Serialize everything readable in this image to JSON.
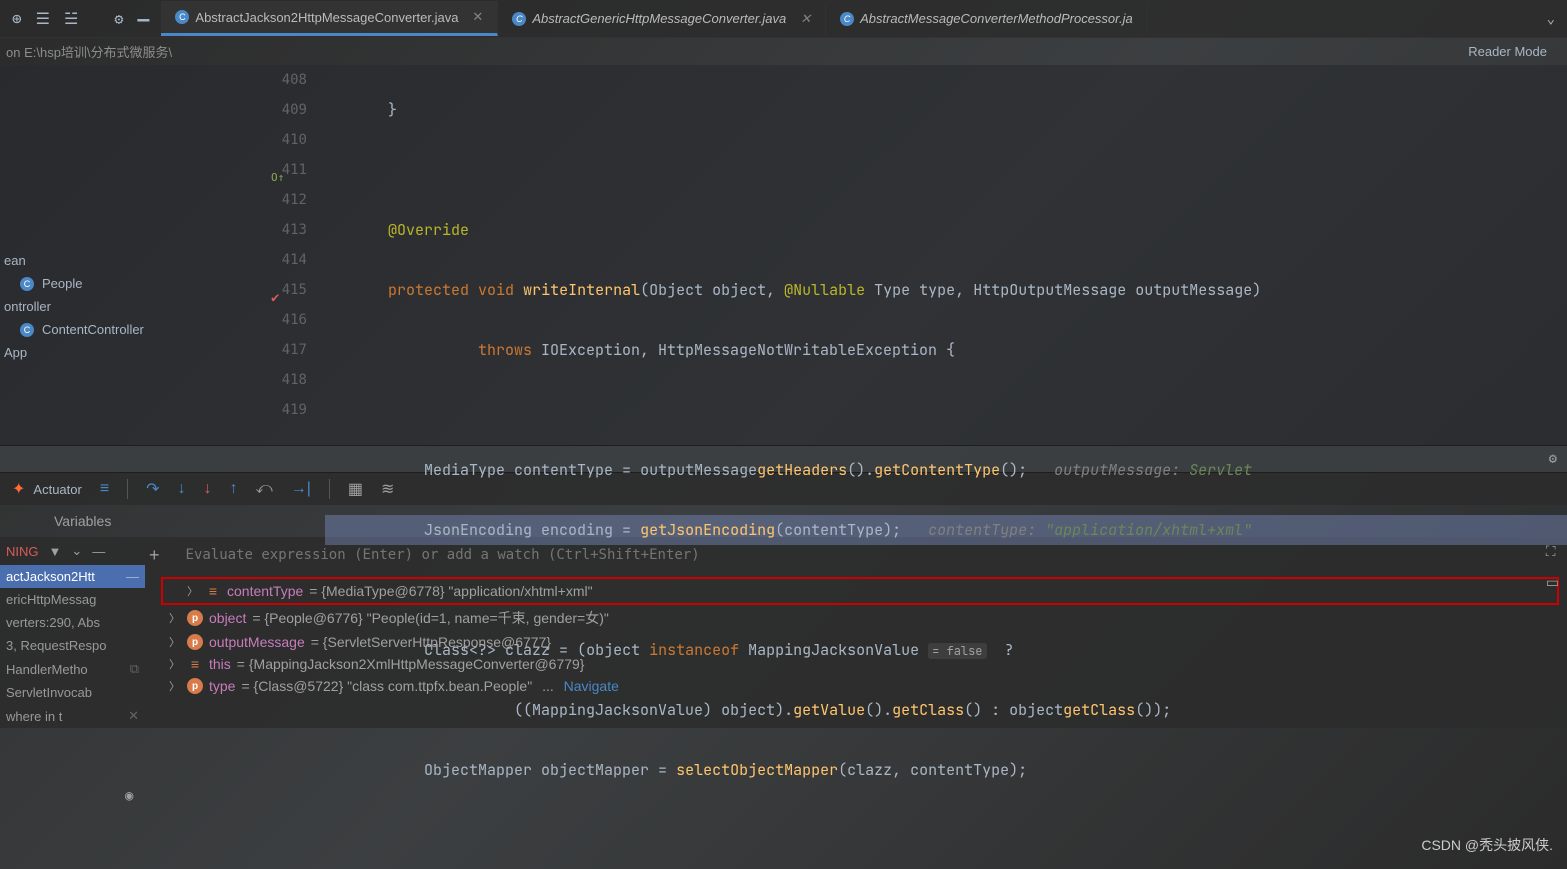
{
  "path_crumb": "on E:\\hsp培训\\分布式微服务\\",
  "reader_mode": "Reader Mode",
  "tabs": [
    {
      "label": "AbstractJackson2HttpMessageConverter.java",
      "active": true,
      "italic": false
    },
    {
      "label": "AbstractGenericHttpMessageConverter.java",
      "active": false,
      "italic": true
    },
    {
      "label": "AbstractMessageConverterMethodProcessor.ja",
      "active": false,
      "italic": true
    }
  ],
  "sidebar": {
    "items": [
      {
        "label": "ean"
      },
      {
        "label": "People",
        "icon": true
      },
      {
        "label": "ontroller"
      },
      {
        "label": "ContentController",
        "icon": true
      },
      {
        "label": "App"
      }
    ]
  },
  "gutter": [
    "408",
    "409",
    "410",
    "411",
    "412",
    "413",
    "414",
    "415",
    "416",
    "417",
    "418",
    "419"
  ],
  "code": {
    "l408": "}",
    "l410_ann": "@Override",
    "l411": {
      "kw1": "protected",
      "kw2": "void",
      "mtd": "writeInternal",
      "p1": "(Object ",
      "par1": "object",
      "c1": ", ",
      "ann": "@Nullable",
      "p2": " Type ",
      "par2": "type",
      "c2": ", HttpOutputMessage ",
      "par3": "outputMessage",
      ")": ")"
    },
    "l412": {
      "kw": "throws",
      "t1": " IOException, HttpMessageNotWritableException {"
    },
    "l414": {
      "t1": "MediaType ",
      "v": "contentType",
      " eq": " = ",
      "v2": "outputMessage",
      ".": ".",
      "m1": "getHeaders",
      "p": "().",
      "m2": "getContentType",
      "e": "();",
      "c": "   outputMessage: ",
      "cv": "Servlet"
    },
    "l415": {
      "t1": "JsonEncoding ",
      "v": "encoding",
      "eq": " = ",
      "m": "getJsonEncoding",
      "p": "(contentType);",
      "c": "   contentType: ",
      "cv": "\"application/xhtml+xml\""
    },
    "l417": {
      "t1": "Class<?> ",
      "v": "clazz",
      "eq": " = (",
      "v2": "object",
      "kw": " instanceof ",
      "t2": "MappingJacksonValue ",
      "hint": "= false",
      "q": "  ?"
    },
    "l418": {
      "p1": "((",
      "t": "MappingJacksonValue",
      "p2": ") ",
      "v": "object",
      "p3": ").",
      "m1": "getValue",
      "p4": "().",
      "m2": "getClass",
      "p5": "() : ",
      "v2": "object",
      ".": ".",
      "m3": "getClass",
      "e": "());"
    },
    "l419": {
      "t1": "ObjectMapper ",
      "v": "objectMapper",
      "eq": " = ",
      "m": "selectObjectMapper",
      "p": "(clazz, contentType);"
    }
  },
  "debug": {
    "actuator": "Actuator",
    "variables_header": "Variables",
    "eval_placeholder": "Evaluate expression (Enter) or add a watch (Ctrl+Shift+Enter)"
  },
  "frames": {
    "status": "NING",
    "items": [
      {
        "label": "actJackson2Htt",
        "active": true
      },
      {
        "label": "ericHttpMessag"
      },
      {
        "label": "verters:290, Abs"
      },
      {
        "label": "3, RequestRespo"
      },
      {
        "label": "HandlerMetho"
      },
      {
        "label": "ServletInvocab"
      },
      {
        "label": "where in t"
      }
    ]
  },
  "variables": [
    {
      "ic": "eq",
      "name": "contentType",
      "val": " = {MediaType@6778} \"application/xhtml+xml\"",
      "boxed": true
    },
    {
      "ic": "p",
      "name": "object",
      "val": " = {People@6776} \"People(id=1, name=千束, gender=女)\""
    },
    {
      "ic": "p",
      "name": "outputMessage",
      "val": " = {ServletServerHttpResponse@6777}"
    },
    {
      "ic": "eq",
      "name": "this",
      "val": " = {MappingJackson2XmlHttpMessageConverter@6779}"
    },
    {
      "ic": "p",
      "name": "type",
      "val": " = {Class@5722} \"class com.ttpfx.bean.People\"",
      "nav": "Navigate"
    }
  ],
  "watermark": "CSDN @秃头披风侠."
}
